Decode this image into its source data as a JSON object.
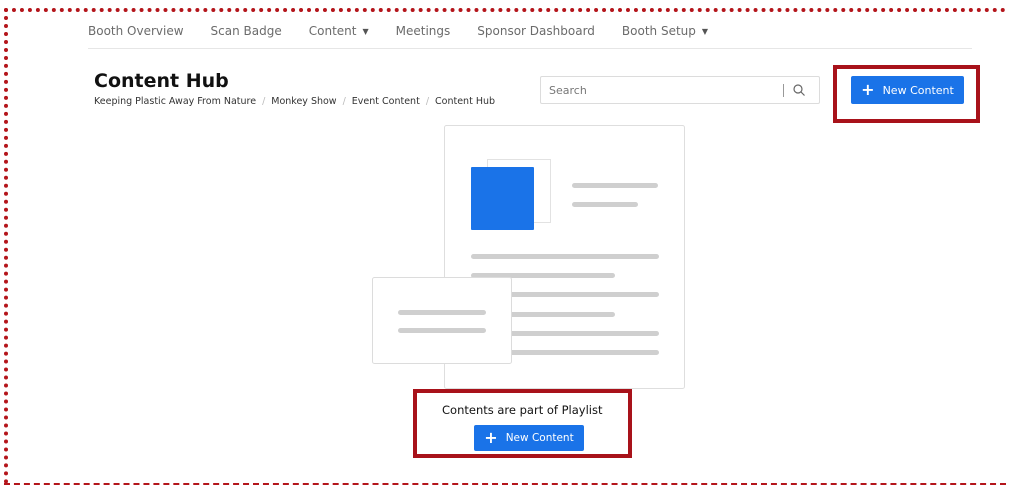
{
  "nav": {
    "items": [
      {
        "label": "Booth Overview",
        "dropdown": false
      },
      {
        "label": "Scan Badge",
        "dropdown": false
      },
      {
        "label": "Content",
        "dropdown": true
      },
      {
        "label": "Meetings",
        "dropdown": false
      },
      {
        "label": "Sponsor Dashboard",
        "dropdown": false
      },
      {
        "label": "Booth Setup",
        "dropdown": true
      }
    ]
  },
  "header": {
    "title": "Content Hub",
    "breadcrumb": [
      "Keeping Plastic Away From Nature",
      "Monkey Show",
      "Event Content",
      "Content Hub"
    ]
  },
  "search": {
    "placeholder": "Search",
    "icon": "search-icon"
  },
  "actions": {
    "new_content_label": "New Content"
  },
  "empty_state": {
    "message": "Contents are part of Playlist",
    "button_label": "New Content"
  },
  "colors": {
    "accent": "#1a73e8",
    "highlight": "#a8121a"
  }
}
